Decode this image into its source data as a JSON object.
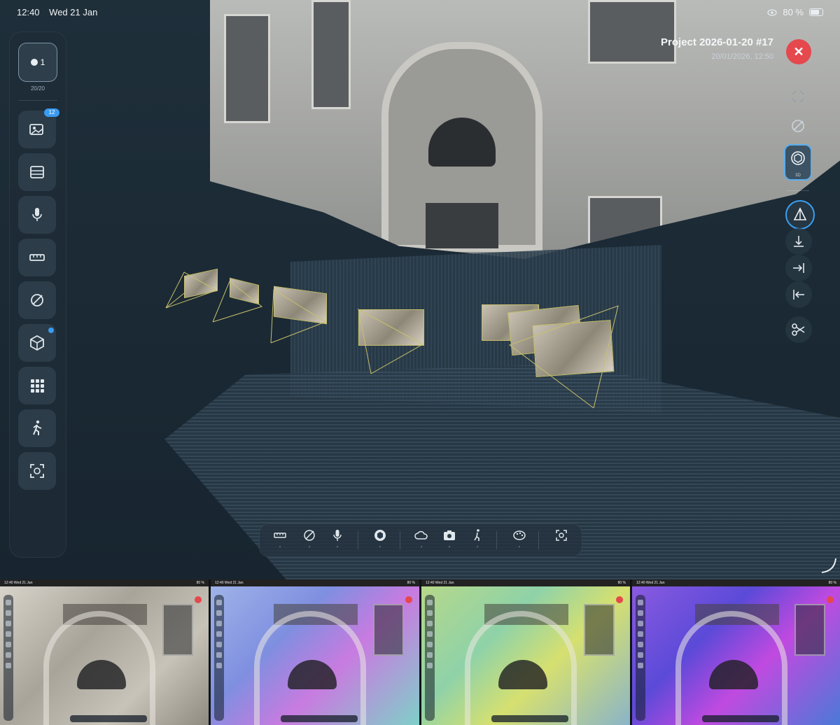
{
  "status_bar": {
    "time": "12:40",
    "date": "Wed 21 Jan",
    "battery": "80 %"
  },
  "project": {
    "name": "Project 2026-01-20 #17",
    "date": "20/01/2026, 12:50"
  },
  "sidebar": {
    "scan_count": "1",
    "scan_sublabel": "20/20",
    "photos_badge": "12",
    "items": [
      "photos-icon",
      "storage-icon",
      "microphone-icon",
      "ruler-icon",
      "angle-icon",
      "cube-icon",
      "grid-icon",
      "walk-icon",
      "scan-frame-icon"
    ]
  },
  "right_tools": {
    "view_label": "3D",
    "items": [
      "expand-icon",
      "angle-icon",
      "cube-view-icon",
      "perspective-icon",
      "floor-align-icon",
      "align-right-icon",
      "align-left-icon",
      "scissors-icon"
    ]
  },
  "toolbar": {
    "items": [
      "ruler-icon",
      "angle-icon",
      "microphone-icon",
      "cube-icon",
      "cloud-icon",
      "camera-icon",
      "walk-icon",
      "palette-icon",
      "scan-frame-icon"
    ]
  },
  "thumbnails": [
    {
      "name": "color"
    },
    {
      "name": "normals"
    },
    {
      "name": "confidence"
    },
    {
      "name": "depth"
    }
  ]
}
